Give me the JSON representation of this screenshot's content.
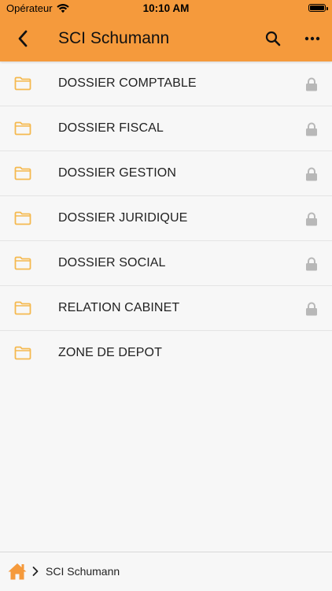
{
  "status_bar": {
    "carrier": "Opérateur",
    "time": "10:10 AM",
    "battery_level": 1.0
  },
  "nav": {
    "title": "SCI Schumann",
    "back_icon": "chevron-left-icon",
    "search_icon": "search-icon",
    "more_icon": "ellipsis-icon"
  },
  "folders": [
    {
      "label": "DOSSIER COMPTABLE",
      "locked": true
    },
    {
      "label": "DOSSIER FISCAL",
      "locked": true
    },
    {
      "label": "DOSSIER GESTION",
      "locked": true
    },
    {
      "label": "DOSSIER JURIDIQUE",
      "locked": true
    },
    {
      "label": "DOSSIER SOCIAL",
      "locked": true
    },
    {
      "label": "RELATION CABINET",
      "locked": true
    },
    {
      "label": "ZONE DE DEPOT",
      "locked": false
    }
  ],
  "breadcrumb": {
    "home_icon": "home-icon",
    "separator_icon": "chevron-right-icon",
    "current": "SCI Schumann"
  },
  "colors": {
    "accent": "#f59a3c",
    "folder": "#f5b94f",
    "lock": "#b8b8b8",
    "home": "#f59a3c"
  }
}
